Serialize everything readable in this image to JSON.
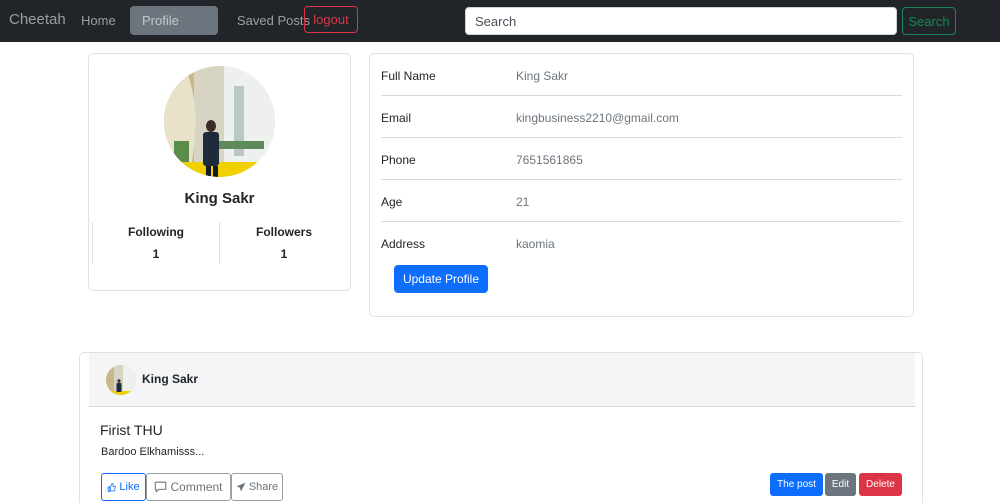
{
  "navbar": {
    "brand": "Cheetah",
    "links": {
      "home": "Home",
      "profile": "Profile",
      "saved": "Saved Posts"
    },
    "logout_label": "logout",
    "search_placeholder": "Search",
    "search_button": "Search"
  },
  "profile": {
    "name": "King Sakr",
    "following_label": "Following",
    "following_count": "1",
    "followers_label": "Followers",
    "followers_count": "1"
  },
  "info": {
    "rows": [
      {
        "label": "Full Name",
        "value": "King Sakr"
      },
      {
        "label": "Email",
        "value": "kingbusiness2210@gmail.com"
      },
      {
        "label": "Phone",
        "value": "7651561865"
      },
      {
        "label": "Age",
        "value": "21"
      },
      {
        "label": "Address",
        "value": "kaomia"
      }
    ],
    "update_button": "Update Profile"
  },
  "post": {
    "author": "King Sakr",
    "title": "Firist THU",
    "body": "Bardoo Elkhamisss...",
    "like_label": "Like",
    "comment_label": "Comment",
    "share_label": "Share",
    "thepost_label": "The post",
    "edit_label": "Edit",
    "delete_label": "Delete"
  },
  "icons": {
    "like": "thumbs-up-icon",
    "comment": "comment-bubble-icon",
    "share": "send-icon"
  },
  "colors": {
    "primary": "#0d6efd",
    "danger": "#dc3545",
    "success": "#198754",
    "secondary": "#6c757d",
    "navbar": "#212529"
  }
}
